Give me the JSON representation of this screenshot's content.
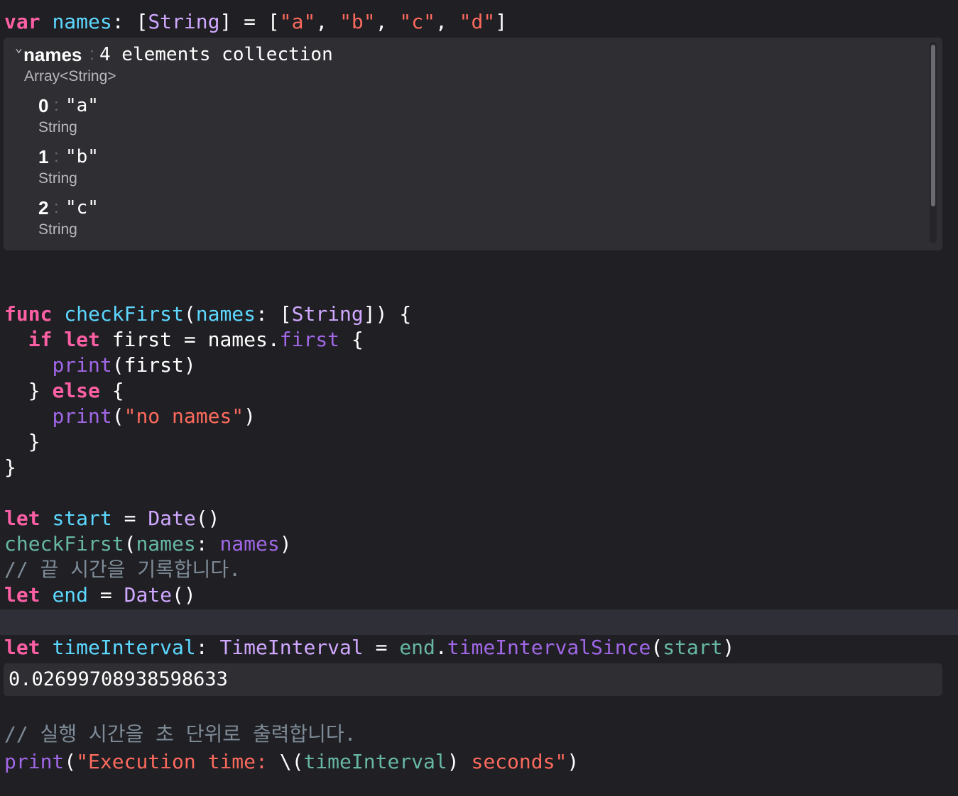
{
  "colors": {
    "background": "#1f1f24",
    "keyword": "#fc5fa3",
    "declaration": "#5dd8ff",
    "type": "#d0a8ff",
    "string": "#fc6a5d",
    "function": "#a167e6",
    "project": "#67b7a4",
    "comment": "#7f8c98"
  },
  "code": {
    "l1": {
      "kw": "var",
      "name": "names",
      "p1": ": [",
      "type": "String",
      "p2": "] = [",
      "a": "\"a\"",
      "c1": ", ",
      "b": "\"b\"",
      "c2": ", ",
      "c": "\"c\"",
      "c3": ", ",
      "d": "\"d\"",
      "p3": "]"
    },
    "l2": {
      "kw": "func",
      "name": "checkFirst",
      "p1": "(",
      "param": "names",
      "p2": ": [",
      "type": "String",
      "p3": "]) {"
    },
    "l3": {
      "ind": "  ",
      "kw1": "if",
      "sp": " ",
      "kw2": "let",
      "rest": " first = names.",
      "prop": "first",
      "end": " {"
    },
    "l4": {
      "ind": "    ",
      "fn": "print",
      "rest": "(first)"
    },
    "l5": {
      "p1": "  } ",
      "kw": "else",
      "p2": " {"
    },
    "l6": {
      "ind": "    ",
      "fn": "print",
      "p1": "(",
      "str": "\"no names\"",
      "p2": ")"
    },
    "l7": {
      "t": "  }"
    },
    "l8": {
      "t": "}"
    },
    "l9": {
      "kw": "let",
      "name": "start",
      "eq": " = ",
      "type": "Date",
      "p": "()"
    },
    "l10": {
      "fn": "checkFirst",
      "p1": "(",
      "lbl": "names",
      "colon": ": ",
      "arg": "names",
      "p2": ")"
    },
    "l11": {
      "comment": "// 끝 시간을 기록합니다."
    },
    "l12": {
      "kw": "let",
      "name": "end",
      "eq": " = ",
      "type": "Date",
      "p": "()"
    },
    "l13": {
      "kw": "let",
      "name": "timeInterval",
      "p1": ": ",
      "type": "TimeInterval",
      "eq": " = ",
      "obj": "end",
      "dot": ".",
      "method": "timeIntervalSince",
      "p2": "(",
      "arg": "start",
      "p3": ")"
    },
    "l14": {
      "comment": "// 실행 시간을 초 단위로 출력합니다."
    },
    "l15": {
      "fn": "print",
      "p1": "(",
      "s1": "\"Execution time: ",
      "interp": "\\(",
      "var": "timeInterval",
      "close": ")",
      "s2": " seconds\"",
      "p2": ")"
    }
  },
  "viewer": {
    "name": "names",
    "colon": ":",
    "summary": "4 elements collection",
    "type": "Array<String>",
    "items": [
      {
        "index": "0",
        "value": "\"a\"",
        "type": "String"
      },
      {
        "index": "1",
        "value": "\"b\"",
        "type": "String"
      },
      {
        "index": "2",
        "value": "\"c\"",
        "type": "String"
      }
    ]
  },
  "result": {
    "value": "0.02699708938598633"
  }
}
